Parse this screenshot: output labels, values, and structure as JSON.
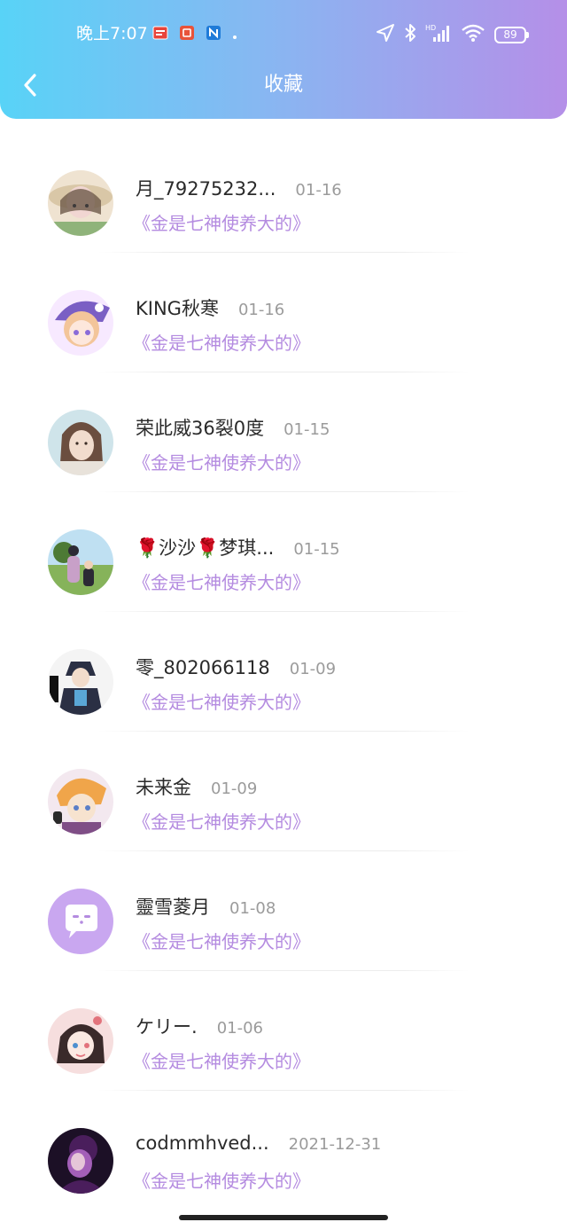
{
  "status_bar": {
    "time": "晚上7:07",
    "battery": "89"
  },
  "header": {
    "title": "收藏"
  },
  "items": [
    {
      "name": "月_79275232...",
      "date": "01-16",
      "book": "《金是七神使养大的》",
      "avatar_colors": [
        "#d9c7a7",
        "#6e5a4a",
        "#f1d6d2"
      ]
    },
    {
      "name": "KING秋寒",
      "date": "01-16",
      "book": "《金是七神使养大的》",
      "avatar_colors": [
        "#7a5fc4",
        "#f3c59a",
        "#f7e9ff"
      ]
    },
    {
      "name": "荣此威36裂0度",
      "date": "01-15",
      "book": "《金是七神使养大的》",
      "avatar_colors": [
        "#cfe4ea",
        "#6b4e3f",
        "#f1dccd"
      ]
    },
    {
      "name": "🌹沙沙🌹梦琪...",
      "date": "01-15",
      "book": "《金是七神使养大的》",
      "avatar_colors": [
        "#86b35a",
        "#2c2a35",
        "#c8a0c8"
      ]
    },
    {
      "name": "零_802066118",
      "date": "01-09",
      "book": "《金是七神使养大的》",
      "avatar_colors": [
        "#f4f4f4",
        "#2b3044",
        "#5aa7d6"
      ]
    },
    {
      "name": "未来金",
      "date": "01-09",
      "book": "《金是七神使养大的》",
      "avatar_colors": [
        "#f0a54a",
        "#7f4e86",
        "#f7e3cf"
      ]
    },
    {
      "name": "靈雪菱月",
      "date": "01-08",
      "book": "《金是七神使养大的》",
      "avatar_colors": [
        "#c9a7f0",
        "#ffffff",
        "#b48be0"
      ]
    },
    {
      "name": "ケリー.",
      "date": "01-06",
      "book": "《金是七神使养大的》",
      "avatar_colors": [
        "#f6dede",
        "#3a2a2a",
        "#e2737c"
      ]
    },
    {
      "name": "codmmhved...",
      "date": "2021-12-31",
      "book": "《金是七神使养大的》",
      "avatar_colors": [
        "#4a1e5c",
        "#a35fb8",
        "#1c1026"
      ]
    }
  ]
}
